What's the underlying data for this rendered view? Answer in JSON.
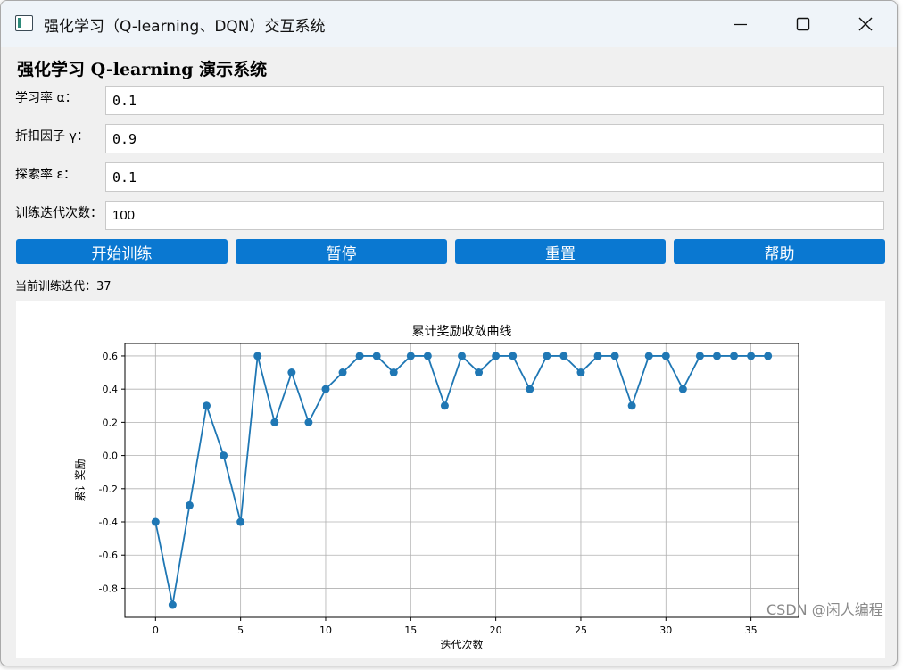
{
  "window": {
    "title": "强化学习（Q-learning、DQN）交互系统"
  },
  "app": {
    "heading": "强化学习 Q-learning 演示系统"
  },
  "fields": {
    "alpha": {
      "label": "学习率 α：",
      "value": "0.1"
    },
    "gamma": {
      "label": "折扣因子 γ：",
      "value": "0.9"
    },
    "epsilon": {
      "label": "探索率 ε：",
      "value": "0.1"
    },
    "iterations": {
      "label": "训练迭代次数：",
      "value": "100"
    }
  },
  "buttons": {
    "start": "开始训练",
    "pause": "暂停",
    "reset": "重置",
    "help": "帮助"
  },
  "status": {
    "current_iteration": "当前训练迭代：37"
  },
  "watermark": "CSDN @闲人编程",
  "colors": {
    "accent": "#0a78d1",
    "series": "#1f77b4"
  },
  "chart_data": {
    "type": "line",
    "title": "累计奖励收敛曲线",
    "xlabel": "迭代次数",
    "ylabel": "累计奖励",
    "x": [
      0,
      1,
      2,
      3,
      4,
      5,
      6,
      7,
      8,
      9,
      10,
      11,
      12,
      13,
      14,
      15,
      16,
      17,
      18,
      19,
      20,
      21,
      22,
      23,
      24,
      25,
      26,
      27,
      28,
      29,
      30,
      31,
      32,
      33,
      34,
      35,
      36
    ],
    "series": [
      {
        "values": [
          -0.4,
          -0.9,
          -0.3,
          0.3,
          0.0,
          -0.4,
          0.6,
          0.2,
          0.5,
          0.2,
          0.4,
          0.5,
          0.6,
          0.6,
          0.5,
          0.6,
          0.6,
          0.3,
          0.6,
          0.5,
          0.6,
          0.6,
          0.4,
          0.6,
          0.6,
          0.5,
          0.6,
          0.6,
          0.3,
          0.6,
          0.6,
          0.4,
          0.6,
          0.6,
          0.6,
          0.6,
          0.6
        ]
      }
    ],
    "xticks": [
      "0",
      "5",
      "10",
      "15",
      "20",
      "25",
      "30",
      "35"
    ],
    "yticks": [
      "-0.8",
      "-0.6",
      "-0.4",
      "-0.2",
      "0.0",
      "0.2",
      "0.4",
      "0.6"
    ],
    "xlim": [
      -1.8,
      37.8
    ],
    "ylim": [
      -0.975,
      0.675
    ],
    "grid": true,
    "markers": true
  }
}
